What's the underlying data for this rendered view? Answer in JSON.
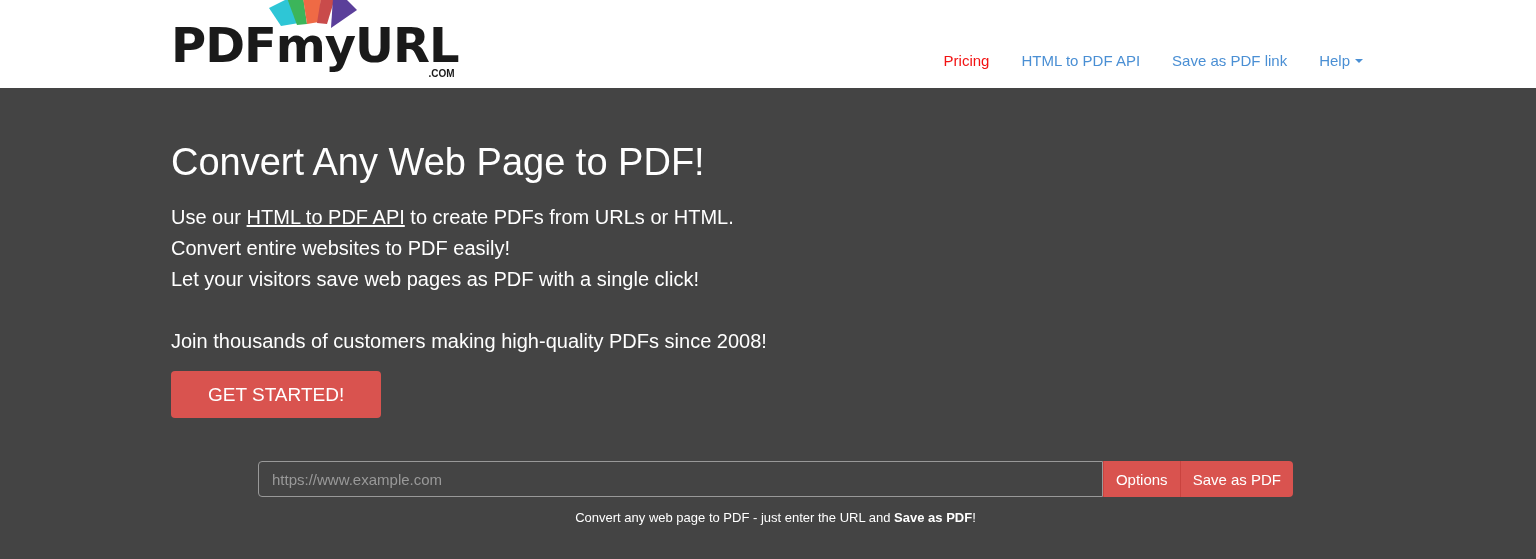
{
  "header": {
    "logo": {
      "name": "PDFmyURL",
      "suffix": ".COM"
    },
    "nav": [
      {
        "label": "Pricing",
        "selected": true
      },
      {
        "label": "HTML to PDF API",
        "selected": false
      },
      {
        "label": "Save as PDF link",
        "selected": false
      },
      {
        "label": "Help",
        "selected": false,
        "kind": "dropdown"
      }
    ]
  },
  "hero": {
    "title": "Convert Any Web Page to PDF!",
    "intro": {
      "before": "Use our ",
      "link": "HTML to PDF API",
      "after": " to create PDFs from URLs or HTML."
    },
    "lines": [
      "Convert entire websites to PDF easily!",
      "Let your visitors save web pages as PDF with a single click!"
    ],
    "tagline": "Join thousands of customers making high-quality PDFs since 2008!",
    "cta": "GET STARTED!"
  },
  "form": {
    "placeholder": "https://www.example.com",
    "buttons": [
      "Options",
      "Save as PDF"
    ],
    "caption": "Convert any web page to PDF - just enter the URL and **Save as PDF**!"
  }
}
